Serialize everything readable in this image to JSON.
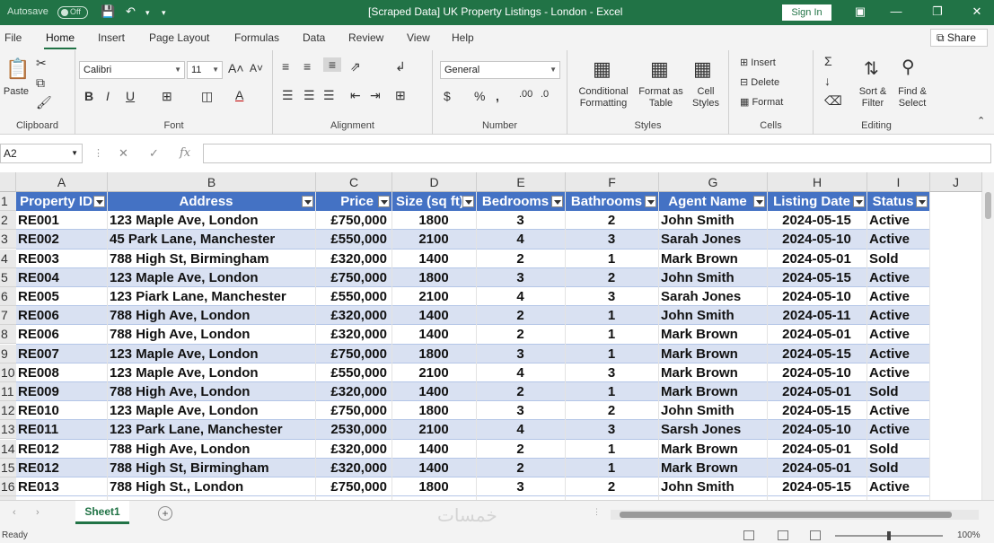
{
  "window": {
    "autosave_label": "Autosave",
    "autosave_state": "Off",
    "title": "[Scraped Data] UK Property Listings - London - Excel",
    "signin_label": "Sign In"
  },
  "menu": {
    "tabs": [
      "File",
      "Home",
      "Insert",
      "Page Layout",
      "Formulas",
      "Data",
      "Review",
      "View",
      "Help"
    ],
    "share_label": "Share"
  },
  "ribbon": {
    "clipboard": {
      "paste": "Paste",
      "label": "Clipboard"
    },
    "font": {
      "name": "Calibri",
      "size": "11",
      "label": "Font"
    },
    "alignment": {
      "label": "Alignment"
    },
    "number": {
      "format": "General",
      "label": "Number"
    },
    "styles": {
      "conditional": "Conditional Formatting",
      "format_table": "Format as Table",
      "cell_styles": "Cell Styles",
      "label": "Styles"
    },
    "cells": {
      "insert": "Insert",
      "delete": "Delete",
      "format": "Format",
      "label": "Cells"
    },
    "editing": {
      "sort": "Sort & Filter",
      "find": "Find & Select",
      "label": "Editing"
    }
  },
  "formula_bar": {
    "name_box": "A2",
    "value": ""
  },
  "grid": {
    "columns": [
      "A",
      "B",
      "C",
      "D",
      "E",
      "F",
      "G",
      "H",
      "I",
      "J"
    ],
    "header_row": [
      "Property ID",
      "Address",
      "Price",
      "Size (sq ft)",
      "Bedrooms",
      "Bathrooms",
      "Agent Name",
      "Listing Date",
      "Status"
    ],
    "rows": [
      [
        "RE001",
        "123 Maple Ave, London",
        "£750,000",
        "1800",
        "3",
        "2",
        "John Smith",
        "2024-05-15",
        "Active"
      ],
      [
        "RE002",
        "45 Park Lane, Manchester",
        "£550,000",
        "2100",
        "4",
        "3",
        "Sarah Jones",
        "2024-05-10",
        "Active"
      ],
      [
        "RE003",
        "788 High St, Birmingham",
        "£320,000",
        "1400",
        "2",
        "1",
        "Mark Brown",
        "2024-05-01",
        "Sold"
      ],
      [
        "RE004",
        "123 Maple Ave, London",
        "£750,000",
        "1800",
        "3",
        "2",
        "John Smith",
        "2024-05-15",
        "Active"
      ],
      [
        "RE005",
        "123 Piark Lane, Manchester",
        "£550,000",
        "2100",
        "4",
        "3",
        "Sarah Jones",
        "2024-05-10",
        "Active"
      ],
      [
        "RE006",
        "788 High Ave, London",
        "£320,000",
        "1400",
        "2",
        "1",
        "John Smith",
        "2024-05-11",
        "Active"
      ],
      [
        "RE006",
        "788 High Ave, London",
        "£320,000",
        "1400",
        "2",
        "1",
        "Mark Brown",
        "2024-05-01",
        "Active"
      ],
      [
        "RE007",
        "123 Maple Ave, London",
        "£750,000",
        "1800",
        "3",
        "1",
        "Mark Brown",
        "2024-05-15",
        "Active"
      ],
      [
        "RE008",
        "123 Maple Ave, London",
        "£550,000",
        "2100",
        "4",
        "3",
        "Mark Brown",
        "2024-05-10",
        "Active"
      ],
      [
        "RE009",
        "788 High Ave, London",
        "£320,000",
        "1400",
        "2",
        "1",
        "Mark Brown",
        "2024-05-01",
        "Sold"
      ],
      [
        "RE010",
        "123 Maple Ave, London",
        "£750,000",
        "1800",
        "3",
        "2",
        "John Smith",
        "2024-05-15",
        "Active"
      ],
      [
        "RE011",
        "123 Park Lane, Manchester",
        "2530,000",
        "2100",
        "4",
        "3",
        "Sarsh Jones",
        "2024-05-10",
        "Active"
      ],
      [
        "RE012",
        "788 High Ave, London",
        "£320,000",
        "1400",
        "2",
        "1",
        "Mark Brown",
        "2024-05-01",
        "Sold"
      ],
      [
        "RE012",
        "788 High St, Birmingham",
        "£320,000",
        "1400",
        "2",
        "1",
        "Mark Brown",
        "2024-05-01",
        "Sold"
      ],
      [
        "RE013",
        "788 High St., London",
        "£750,000",
        "1800",
        "3",
        "2",
        "John Smith",
        "2024-05-15",
        "Active"
      ]
    ]
  },
  "sheets": {
    "active": "Sheet1"
  },
  "status": {
    "ready": "Ready",
    "zoom": "100%"
  },
  "colors": {
    "excel_green": "#217346",
    "table_header": "#4472c4",
    "band": "#d9e1f2"
  },
  "watermark": "خمسات"
}
